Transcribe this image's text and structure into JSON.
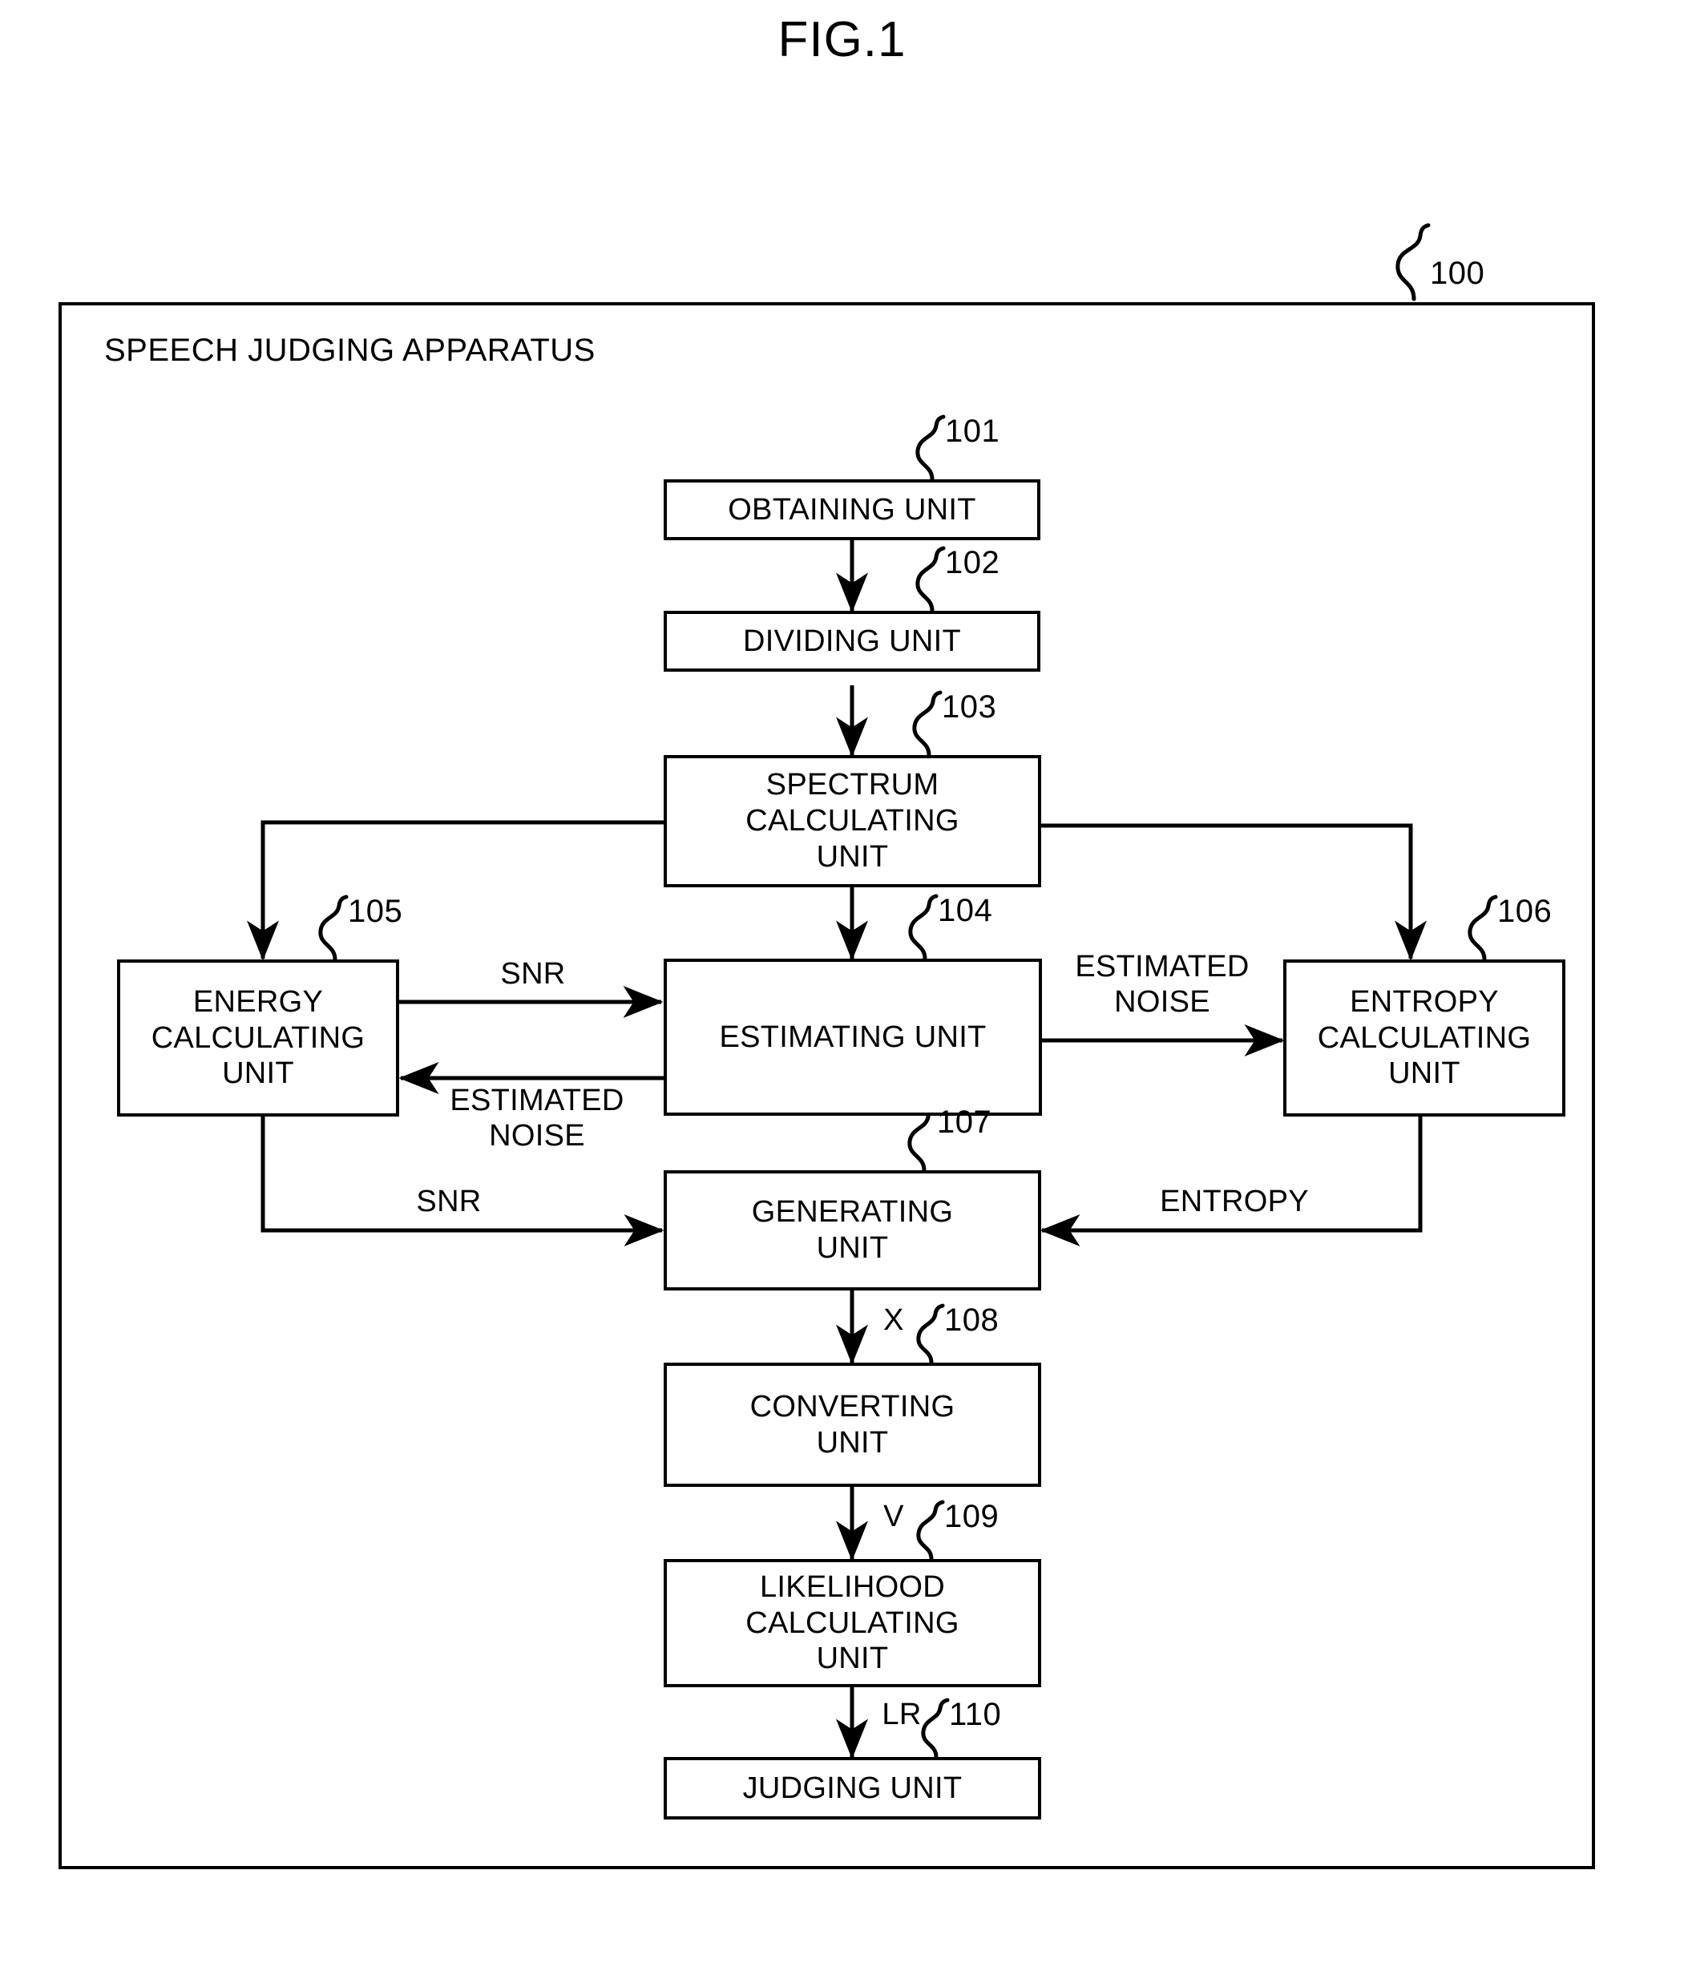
{
  "figure": {
    "title": "FIG.1",
    "apparatus_label": "SPEECH JUDGING APPARATUS",
    "apparatus_ref": "100"
  },
  "units": {
    "obtaining": {
      "label": "OBTAINING UNIT",
      "ref": "101"
    },
    "dividing": {
      "label": "DIVIDING UNIT",
      "ref": "102"
    },
    "spectrum": {
      "label": "SPECTRUM\nCALCULATING\nUNIT",
      "ref": "103"
    },
    "estimating": {
      "label": "ESTIMATING UNIT",
      "ref": "104"
    },
    "energy": {
      "label": "ENERGY\nCALCULATING\nUNIT",
      "ref": "105"
    },
    "entropy": {
      "label": "ENTROPY\nCALCULATING\nUNIT",
      "ref": "106"
    },
    "generating": {
      "label": "GENERATING\nUNIT",
      "ref": "107"
    },
    "converting": {
      "label": "CONVERTING\nUNIT",
      "ref": "108"
    },
    "likelihood": {
      "label": "LIKELIHOOD\nCALCULATING\nUNIT",
      "ref": "109"
    },
    "judging": {
      "label": "JUDGING UNIT",
      "ref": "110"
    }
  },
  "signals": {
    "snr_to_estimating": "SNR",
    "estimated_noise_to_energy": "ESTIMATED\nNOISE",
    "estimated_noise_to_entropy": "ESTIMATED\nNOISE",
    "snr_to_generating": "SNR",
    "entropy_to_generating": "ENTROPY",
    "x_to_converting": "X",
    "v_to_likelihood": "V",
    "lr_to_judging": "LR"
  },
  "colors": {
    "line": "#000000",
    "background": "#ffffff"
  }
}
